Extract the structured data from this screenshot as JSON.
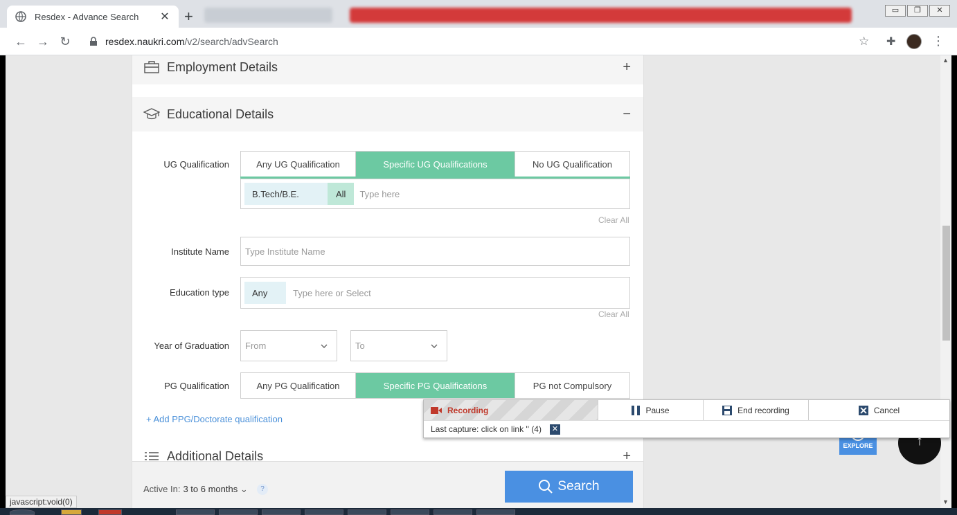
{
  "browser": {
    "tab_title": "Resdex - Advance Search",
    "tab_close": "✕",
    "new_tab": "+",
    "url_host": "resdex.naukri.com",
    "url_path": "/v2/search/advSearch"
  },
  "sections": {
    "employment": {
      "title": "Employment Details",
      "toggle": "+"
    },
    "education": {
      "title": "Educational Details",
      "toggle": "−"
    },
    "additional": {
      "title": "Additional Details",
      "toggle": "+"
    }
  },
  "ug": {
    "label": "UG Qualification",
    "options": [
      "Any UG Qualification",
      "Specific UG Qualifications",
      "No UG Qualification"
    ],
    "selected_index": 1,
    "chip": "B.Tech/B.E.",
    "chip_all": "All",
    "placeholder": "Type here",
    "clear_all": "Clear All"
  },
  "institute": {
    "label": "Institute Name",
    "placeholder": "Type Institute Name"
  },
  "education_type": {
    "label": "Education type",
    "chip": "Any",
    "placeholder": "Type here or Select",
    "clear_all": "Clear All"
  },
  "graduation_year": {
    "label": "Year of Graduation",
    "from": "From",
    "to": "To"
  },
  "pg": {
    "label": "PG Qualification",
    "options": [
      "Any PG Qualification",
      "Specific PG Qualifications",
      "PG not Compulsory"
    ],
    "selected_index": 1
  },
  "add_ppg_link": "+ Add PPG/Doctorate qualification",
  "bottom": {
    "active_in_label": "Active In:",
    "active_in_value": "3 to 6 months",
    "help": "?",
    "search_label": "Search"
  },
  "explore_label": "EXPLORE",
  "status_tip": "javascript:void(0)",
  "recorder": {
    "recording": "Recording",
    "pause": "Pause",
    "end": "End recording",
    "cancel": "Cancel",
    "last_capture": "Last capture: click on link '' (4)"
  },
  "colors": {
    "accent_green": "#6cc9a2",
    "search_blue": "#4a90e2",
    "recording_red": "#c0392b"
  }
}
